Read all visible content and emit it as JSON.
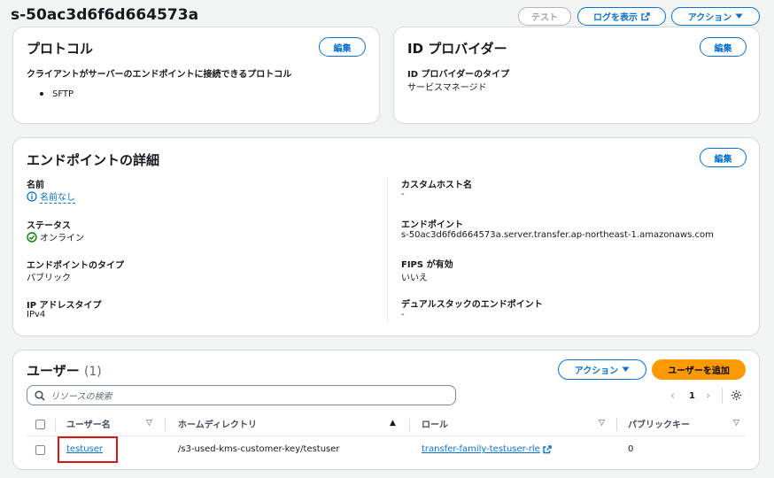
{
  "header": {
    "title": "s-50ac3d6f6d664573a",
    "test_label": "テスト",
    "logs_label": "ログを表示",
    "actions_label": "アクション"
  },
  "protocol": {
    "title": "プロトコル",
    "edit_label": "編集",
    "field_label": "クライアントがサーバーのエンドポイントに接続できるプロトコル",
    "items": [
      "SFTP"
    ]
  },
  "idp": {
    "title": "ID プロバイダー",
    "edit_label": "編集",
    "type_label": "ID プロバイダーのタイプ",
    "type_value": "サービスマネージド"
  },
  "endpoint": {
    "title": "エンドポイントの詳細",
    "edit_label": "編集",
    "name_label": "名前",
    "name_value": "名前なし",
    "status_label": "ステータス",
    "status_value": "オンライン",
    "type_label": "エンドポイントのタイプ",
    "type_value": "パブリック",
    "ip_label": "IP アドレスタイプ",
    "ip_value": "IPv4",
    "custom_host_label": "カスタムホスト名",
    "custom_host_value": "-",
    "endpoint_label": "エンドポイント",
    "endpoint_value": "s-50ac3d6f6d664573a.server.transfer.ap-northeast-1.amazonaws.com",
    "fips_label": "FIPS が有効",
    "fips_value": "いいえ",
    "dualstack_label": "デュアルスタックのエンドポイント",
    "dualstack_value": "-"
  },
  "users": {
    "title": "ユーザー",
    "count": "(1)",
    "actions_label": "アクション",
    "add_label": "ユーザーを追加",
    "search_placeholder": "リソースの検索",
    "page": "1",
    "columns": [
      "ユーザー名",
      "ホームディレクトリ",
      "ロール",
      "パブリックキー"
    ],
    "rows": [
      {
        "username": "testuser",
        "home": "/s3-used-kms-customer-key/testuser",
        "role": "transfer-family-testuser-rle",
        "keys": "0"
      }
    ]
  },
  "colors": {
    "link": "#0972d3",
    "primary": "#ff9900",
    "success": "#037f0c",
    "highlight": "#d91515"
  }
}
